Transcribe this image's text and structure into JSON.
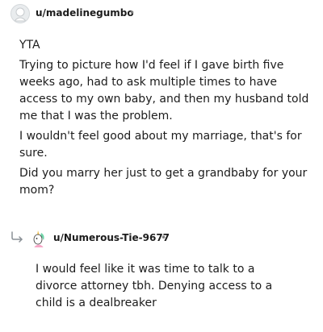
{
  "comment": {
    "username": "u/madelinegumbo",
    "separator": "•",
    "paragraphs": [
      "YTA",
      "Trying to picture how I'd feel if I gave birth five weeks ago, had to ask multiple times to have access to my own baby, and then my husband told me that I was the problem.",
      "I wouldn't feel good about my marriage, that's for sure.",
      "Did you marry her just to get a grandbaby for your mom?"
    ]
  },
  "reply": {
    "username": "u/Numerous-Tie-9677",
    "separator": "•",
    "text": "I would feel like it was time to talk to a divorce attorney tbh. Denying access to a child is a dealbreaker"
  },
  "icons": {
    "main_avatar": "default-avatar-icon",
    "reply_avatar": "unicorn-avatar-icon",
    "reply_arrow": "reply-arrow-icon"
  }
}
